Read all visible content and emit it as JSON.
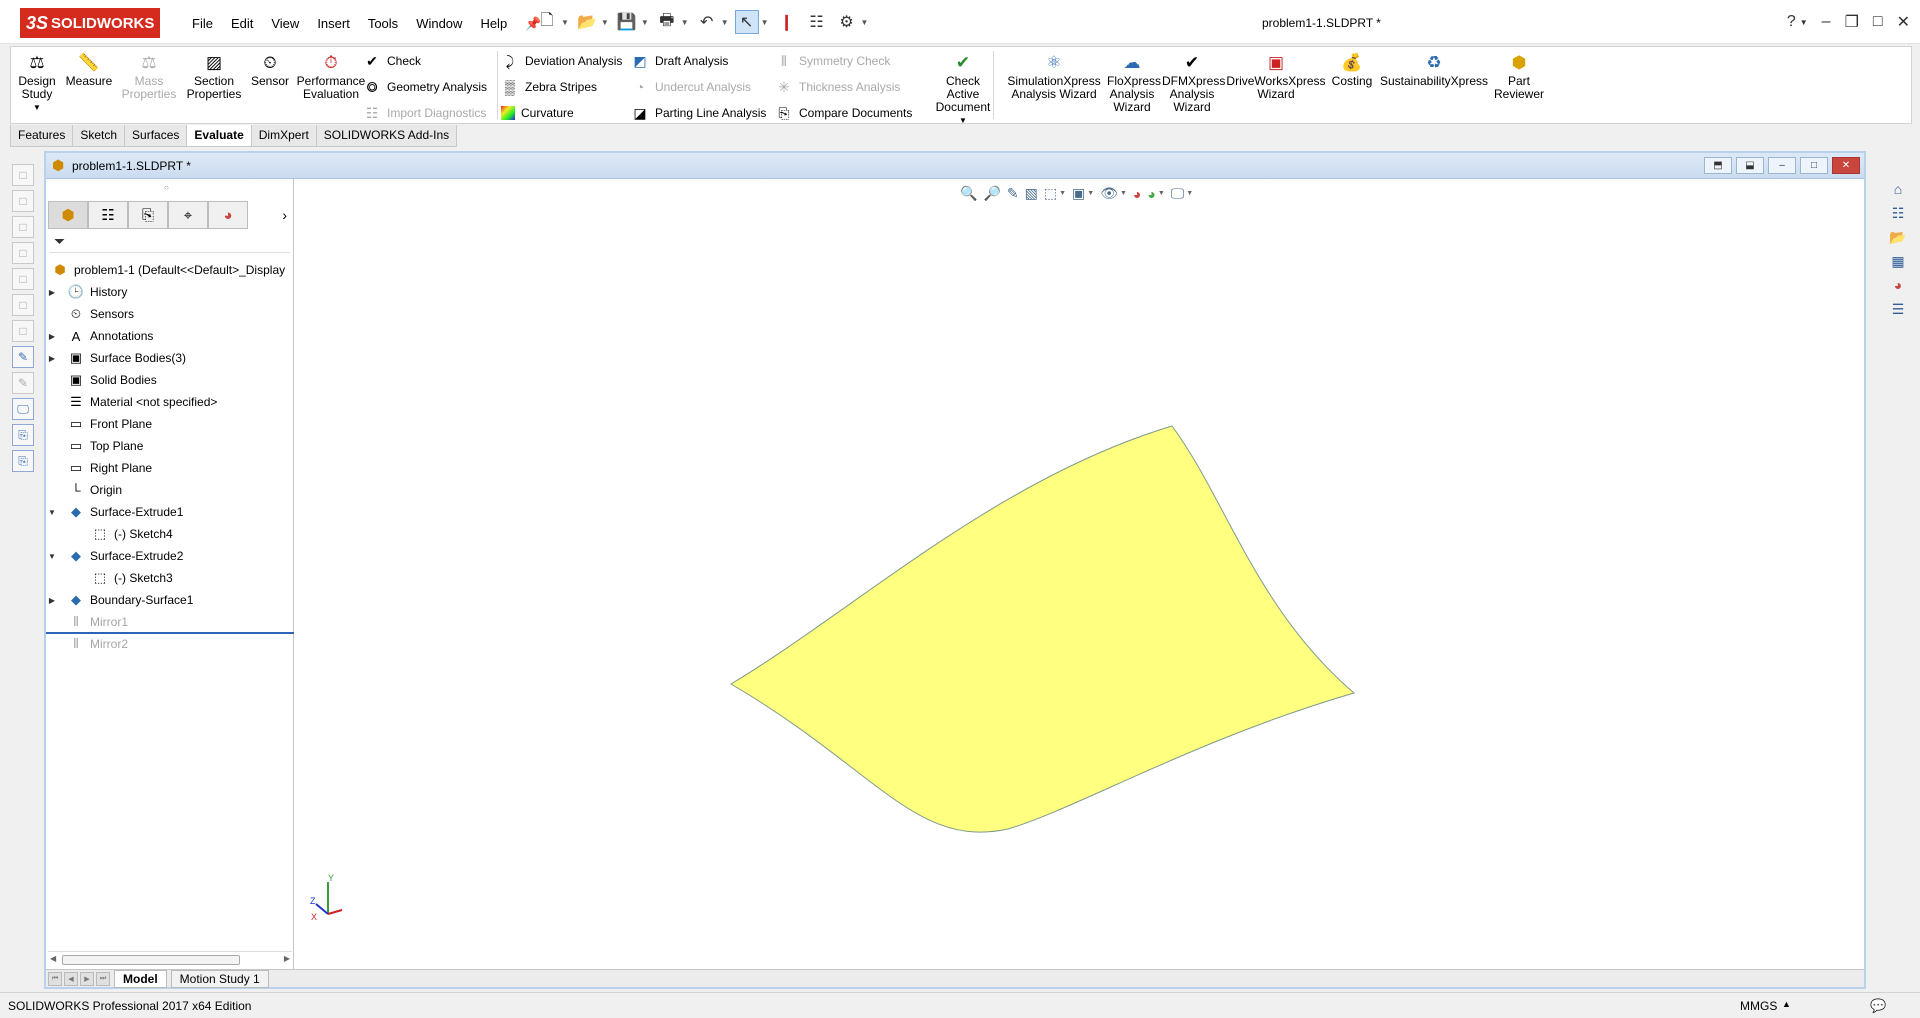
{
  "app": {
    "brand": "SOLIDWORKS",
    "document_title": "problem1-1.SLDPRT *"
  },
  "menu": [
    "File",
    "Edit",
    "View",
    "Insert",
    "Tools",
    "Window",
    "Help"
  ],
  "toolbar": {
    "design_study": "Design Study",
    "measure": "Measure",
    "mass_properties": "Mass Properties",
    "section_properties": "Section Properties",
    "sensor": "Sensor",
    "performance_evaluation": "Performance Evaluation",
    "check": "Check",
    "geometry_analysis": "Geometry Analysis",
    "import_diagnostics": "Import Diagnostics",
    "deviation_analysis": "Deviation Analysis",
    "zebra_stripes": "Zebra Stripes",
    "curvature": "Curvature",
    "draft_analysis": "Draft Analysis",
    "undercut_analysis": "Undercut Analysis",
    "parting_line_analysis": "Parting Line Analysis",
    "symmetry_check": "Symmetry Check",
    "thickness_analysis": "Thickness Analysis",
    "compare_documents": "Compare Documents",
    "check_active_document": "Check Active Document",
    "simulationxpress": "SimulationXpress Analysis Wizard",
    "floxpress": "FloXpress Analysis Wizard",
    "dfmxpress": "DFMXpress Analysis Wizard",
    "driveworksxpress": "DriveWorksXpress Wizard",
    "costing": "Costing",
    "sustainabilityxpress": "SustainabilityXpress",
    "part_reviewer": "Part Reviewer"
  },
  "cm_tabs": [
    "Features",
    "Sketch",
    "Surfaces",
    "Evaluate",
    "DimXpert",
    "SOLIDWORKS Add-Ins"
  ],
  "doc_window": {
    "title": "problem1-1.SLDPRT *"
  },
  "tree": {
    "root": "problem1-1  (Default<<Default>_Display",
    "items": [
      {
        "label": "History"
      },
      {
        "label": "Sensors"
      },
      {
        "label": "Annotations"
      },
      {
        "label": "Surface Bodies(3)"
      },
      {
        "label": "Solid Bodies"
      },
      {
        "label": "Material <not specified>"
      },
      {
        "label": "Front Plane"
      },
      {
        "label": "Top Plane"
      },
      {
        "label": "Right Plane"
      },
      {
        "label": "Origin"
      },
      {
        "label": "Surface-Extrude1"
      },
      {
        "label": "(-) Sketch4"
      },
      {
        "label": "Surface-Extrude2"
      },
      {
        "label": "(-) Sketch3"
      },
      {
        "label": "Boundary-Surface1"
      },
      {
        "label": "Mirror1"
      },
      {
        "label": "Mirror2"
      }
    ]
  },
  "bottom_tabs": [
    "Model",
    "Motion Study 1"
  ],
  "triad": {
    "x": "X",
    "y": "Y",
    "z": "Z"
  },
  "status": {
    "text": "SOLIDWORKS Professional 2017 x64 Edition",
    "units": "MMGS"
  },
  "colors": {
    "surface_fill": "#ffff80",
    "brand_red": "#d52b1e",
    "rollback_bar": "#2c64b7"
  }
}
